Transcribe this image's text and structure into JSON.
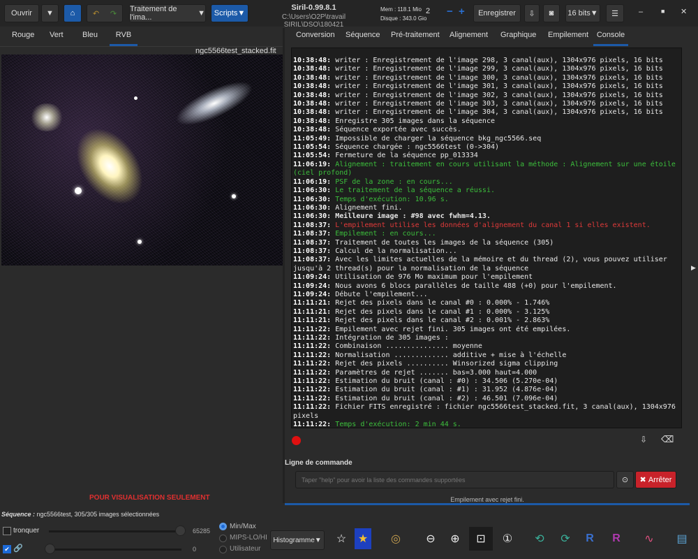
{
  "toolbar": {
    "open": "Ouvrir",
    "processing": "Traitement de l'ima...",
    "scripts": "Scripts",
    "title": "Siril-0.99.8.1",
    "path": "C:\\Users\\O2P\\travail SIRIL\\DSO\\180421",
    "mem": "Mem : 118.1 Mio",
    "disk": "Disque : 343.0 Gio",
    "threads": "2",
    "save": "Enregistrer",
    "bitdepth": "16 bits"
  },
  "left_tabs": [
    "Rouge",
    "Vert",
    "Bleu",
    "RVB"
  ],
  "image": {
    "filename": "ngc5566test_stacked.fit",
    "notice": "POUR VISUALISATION SEULEMENT"
  },
  "right_tabs": [
    "Conversion",
    "Séquence",
    "Pré-traitement",
    "Alignement",
    "Graphique",
    "Empilement",
    "Console"
  ],
  "console": [
    {
      "t": "10:38:48:",
      "m": " writer : Enregistrement de l'image 298, 3 canal(aux), 1304x976 pixels, 16 bits",
      "s": ""
    },
    {
      "t": "10:38:48:",
      "m": " writer : Enregistrement de l'image 299, 3 canal(aux), 1304x976 pixels, 16 bits",
      "s": ""
    },
    {
      "t": "10:38:48:",
      "m": " writer : Enregistrement de l'image 300, 3 canal(aux), 1304x976 pixels, 16 bits",
      "s": ""
    },
    {
      "t": "10:38:48:",
      "m": " writer : Enregistrement de l'image 301, 3 canal(aux), 1304x976 pixels, 16 bits",
      "s": ""
    },
    {
      "t": "10:38:48:",
      "m": " writer : Enregistrement de l'image 302, 3 canal(aux), 1304x976 pixels, 16 bits",
      "s": ""
    },
    {
      "t": "10:38:48:",
      "m": " writer : Enregistrement de l'image 303, 3 canal(aux), 1304x976 pixels, 16 bits",
      "s": ""
    },
    {
      "t": "10:38:48:",
      "m": " writer : Enregistrement de l'image 304, 3 canal(aux), 1304x976 pixels, 16 bits",
      "s": ""
    },
    {
      "t": "10:38:48:",
      "m": " Enregistre 305 images dans la séquence",
      "s": ""
    },
    {
      "t": "10:38:48:",
      "m": " Séquence exportée avec succès.",
      "s": ""
    },
    {
      "t": "11:05:49:",
      "m": " Impossible de charger la séquence bkg_ngc5566.seq",
      "s": ""
    },
    {
      "t": "11:05:54:",
      "m": " Séquence chargée : ngc5566test (0->304)",
      "s": ""
    },
    {
      "t": "11:05:54:",
      "m": " Fermeture de la séquence pp_013334",
      "s": ""
    },
    {
      "t": "11:06:19:",
      "m": " Alignement : traitement en cours utilisant la méthode : Alignement sur une étoile (ciel profond)",
      "s": "green"
    },
    {
      "t": "11:06:19:",
      "m": " PSF de la zone : en cours...",
      "s": "green"
    },
    {
      "t": "11:06:30:",
      "m": " Le traitement de la séquence a réussi.",
      "s": "green"
    },
    {
      "t": "11:06:30:",
      "m": " Temps d'exécution: 10.96 s.",
      "s": "green"
    },
    {
      "t": "11:06:30:",
      "m": " Alignement fini.",
      "s": ""
    },
    {
      "t": "11:06:30:",
      "m": " Meilleure image : #98 avec fwhm=4.13.",
      "s": "bold"
    },
    {
      "t": "11:08:37:",
      "m": " L'empilement utilise les données d'alignement du canal 1 si elles existent.",
      "s": "red"
    },
    {
      "t": "11:08:37:",
      "m": " Empilement : en cours...",
      "s": "green"
    },
    {
      "t": "11:08:37:",
      "m": " Traitement de toutes les images de la séquence (305)",
      "s": ""
    },
    {
      "t": "11:08:37:",
      "m": " Calcul de la normalisation...",
      "s": ""
    },
    {
      "t": "11:08:37:",
      "m": " Avec les limites actuelles de la mémoire et du thread (2), vous pouvez utiliser jusqu'à 2 thread(s) pour la normalisation de la séquence",
      "s": ""
    },
    {
      "t": "11:09:24:",
      "m": " Utilisation de 976 Mo maximum pour l'empilement",
      "s": ""
    },
    {
      "t": "11:09:24:",
      "m": " Nous avons 6 blocs parallèles de taille 488 (+0) pour l'empilement.",
      "s": ""
    },
    {
      "t": "11:09:24:",
      "m": " Débute l'empilement...",
      "s": ""
    },
    {
      "t": "11:11:21:",
      "m": " Rejet des pixels dans le canal #0 : 0.000% - 1.746%",
      "s": ""
    },
    {
      "t": "11:11:21:",
      "m": " Rejet des pixels dans le canal #1 : 0.000% - 3.125%",
      "s": ""
    },
    {
      "t": "11:11:21:",
      "m": " Rejet des pixels dans le canal #2 : 0.001% - 2.863%",
      "s": ""
    },
    {
      "t": "11:11:22:",
      "m": " Empilement avec rejet fini. 305 images ont été empilées.",
      "s": ""
    },
    {
      "t": "11:11:22:",
      "m": " Intégration de 305 images :",
      "s": ""
    },
    {
      "t": "11:11:22:",
      "m": " Combinaison ............... moyenne",
      "s": ""
    },
    {
      "t": "11:11:22:",
      "m": " Normalisation ............. additive + mise à l'échelle",
      "s": ""
    },
    {
      "t": "11:11:22:",
      "m": " Rejet des pixels .......... Winsorized sigma clipping",
      "s": ""
    },
    {
      "t": "11:11:22:",
      "m": " Paramètres de rejet ....... bas=3.000 haut=4.000",
      "s": ""
    },
    {
      "t": "11:11:22:",
      "m": " Estimation du bruit (canal : #0) : 34.506 (5.270e-04)",
      "s": ""
    },
    {
      "t": "11:11:22:",
      "m": " Estimation du bruit (canal : #1) : 31.952 (4.876e-04)",
      "s": ""
    },
    {
      "t": "11:11:22:",
      "m": " Estimation du bruit (canal : #2) : 46.501 (7.096e-04)",
      "s": ""
    },
    {
      "t": "11:11:22:",
      "m": " Fichier FITS enregistré : fichier ngc5566test_stacked.fit, 3 canal(aux), 1304x976 pixels",
      "s": ""
    },
    {
      "t": "11:11:22:",
      "m": " Temps d'exécution: 2 min 44 s.",
      "s": "green"
    }
  ],
  "command": {
    "label": "Ligne de commande",
    "placeholder": "Taper \"help\" pour avoir la liste des commandes supportées",
    "stop": "Arrêter",
    "status": "Empilement avec rejet fini.",
    "progress": 1.0
  },
  "sequence": {
    "label": "Séquence :",
    "value": " ngc5566test, 305/305 images sélectionnées"
  },
  "display": {
    "clip": "tronquer",
    "max": "65285",
    "min": "0",
    "modes": [
      "Min/Max",
      "MIPS-LO/HI",
      "Utilisateur"
    ],
    "selected_mode": "Min/Max",
    "histogram": "Histogramme"
  },
  "colors": {
    "accent": "#1c5aa8",
    "stop": "#c8222a",
    "green": "#3cbf3c",
    "red": "#e03a3a"
  }
}
